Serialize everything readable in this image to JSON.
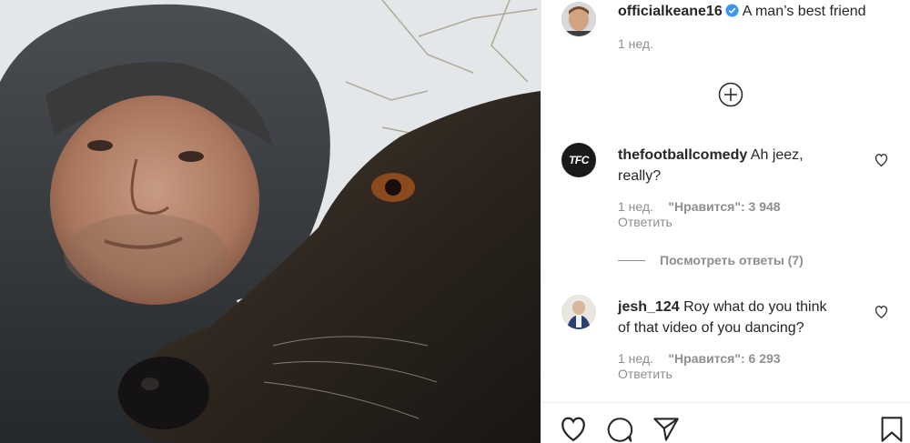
{
  "post": {
    "author": "officialkeane16",
    "caption": "A man’s best friend",
    "time": "1 нед."
  },
  "comments": [
    {
      "username": "thefootballcomedy",
      "text_line1": "Ah jeez,",
      "text_line2": "really?",
      "time": "1 нед.",
      "likes": "\"Нравится\": 3 948",
      "reply": "Ответить",
      "avatar_text": "TFC",
      "view_replies": "Посмотреть ответы (7)"
    },
    {
      "username": "jesh_124",
      "text_line1": "Roy what do you think",
      "text_line2": "of that video of you dancing?",
      "time": "1 нед.",
      "likes": "\"Нравится\": 6 293",
      "reply": "Ответить"
    }
  ],
  "colors": {
    "verified": "#3897f0",
    "muted": "#8e8e8e",
    "text": "#262626"
  },
  "icons": [
    "verified-badge-icon",
    "load-more-icon",
    "heart-icon",
    "comment-icon",
    "share-icon",
    "bookmark-icon"
  ]
}
